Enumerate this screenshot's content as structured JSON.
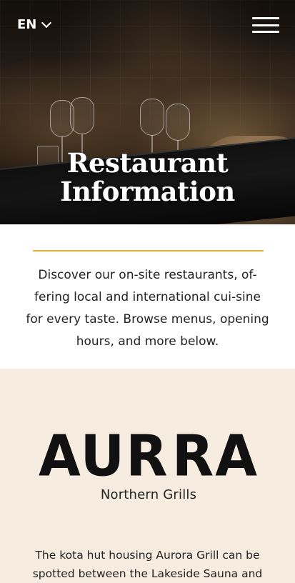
{
  "header": {
    "language": "EN",
    "menu_icon": "hamburger-icon",
    "language_icon": "chevron-down-icon"
  },
  "hero": {
    "title_line1": "Restaurant",
    "title_line2": "Information"
  },
  "intro": {
    "accent_color": "#e0ac2c",
    "text": "Discover our on-site restaurants, of-fering local and international cui-sine for every taste. Browse menus, opening hours, and more below."
  },
  "restaurant": {
    "logo_word_left": "AUR",
    "logo_word_right": "RA",
    "logo_subtitle": "Northern Grills",
    "logo_icon": "flame-icon",
    "background": "#f6ece0",
    "description": "The kota hut housing Aurora Grill can be spotted between the Lakeside Sauna and"
  }
}
